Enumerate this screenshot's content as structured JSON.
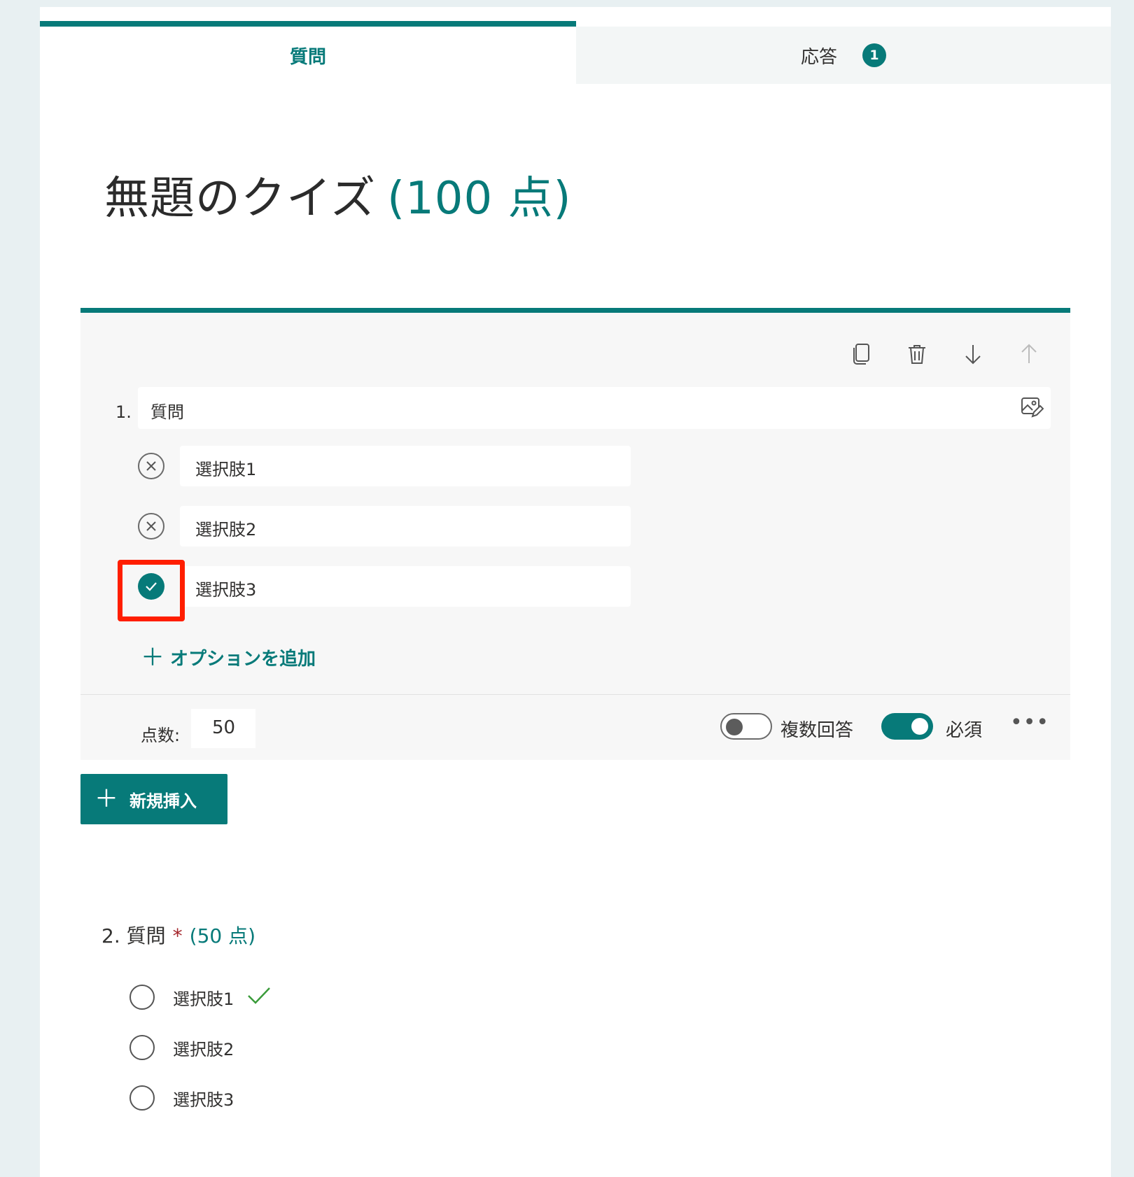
{
  "tabs": {
    "questions_label": "質問",
    "responses_label": "応答",
    "responses_badge": "1"
  },
  "quiz": {
    "title": "無題のクイズ",
    "points": "(100 点)"
  },
  "question1": {
    "number": "1.",
    "text": "質問",
    "options": [
      {
        "label": "選択肢1",
        "correct": false
      },
      {
        "label": "選択肢2",
        "correct": false
      },
      {
        "label": "選択肢3",
        "correct": true
      }
    ],
    "add_option_label": "オプションを追加",
    "score_label": "点数:",
    "score_value": "50",
    "multiple_answers_label": "複数回答",
    "multiple_answers_on": false,
    "required_label": "必須",
    "required_on": true,
    "more_label": "•••",
    "toolbar_icons": [
      "copy-icon",
      "trash-icon",
      "arrow-down-icon",
      "arrow-up-icon"
    ]
  },
  "insert_button_label": "新規挿入",
  "question2": {
    "number": "2.",
    "text": "質問",
    "required_mark": "*",
    "points": "(50 点)",
    "options": [
      "選択肢1",
      "選択肢2",
      "選択肢3"
    ],
    "correct_option_index": 0
  },
  "colors": {
    "accent": "#077a79",
    "highlight": "#ff1e00",
    "required": "#a4262c",
    "correct_check": "#3a9b3a"
  }
}
